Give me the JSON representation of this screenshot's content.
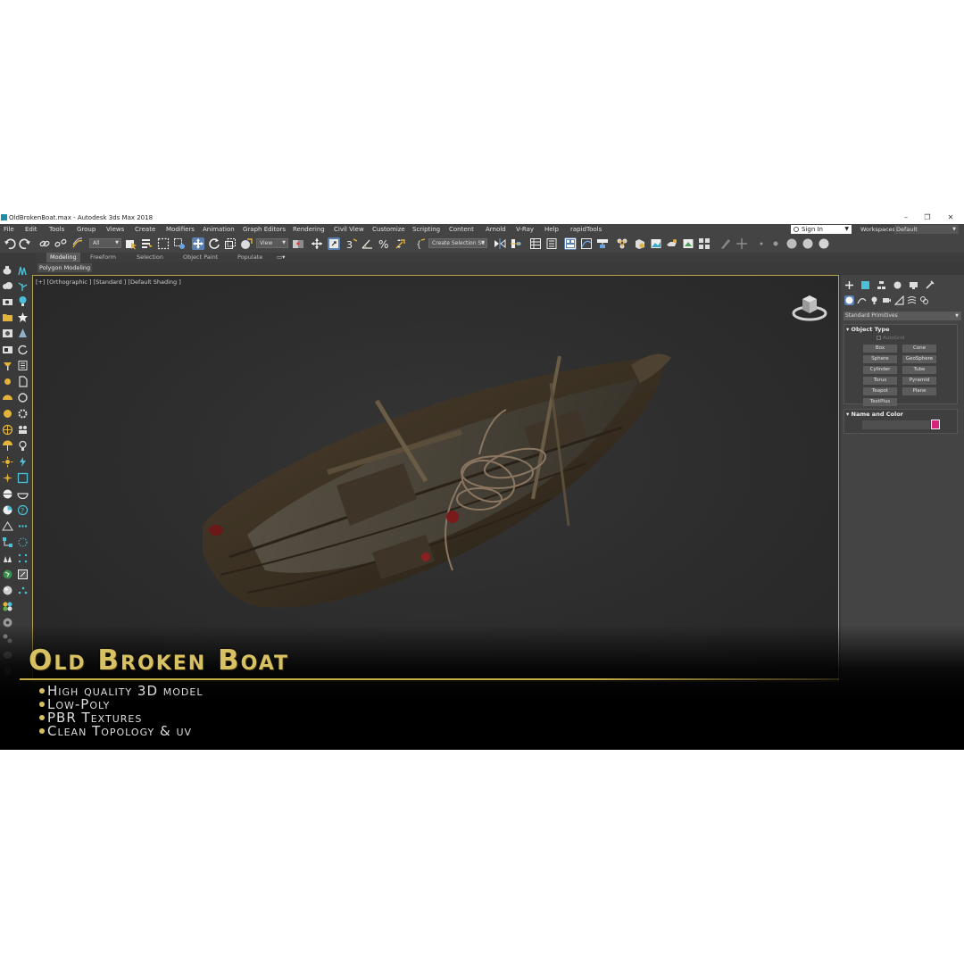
{
  "window": {
    "title": "OldBrokenBoat.max - Autodesk 3ds Max 2018",
    "controls": [
      "–",
      "❐",
      "✕"
    ]
  },
  "menubar": {
    "items": [
      "File",
      "Edit",
      "Tools",
      "Group",
      "Views",
      "Create",
      "Modifiers",
      "Animation",
      "Graph Editors",
      "Rendering",
      "Civil View",
      "Customize",
      "Scripting",
      "Content",
      "Arnold",
      "V-Ray",
      "Help",
      "rapidTools"
    ],
    "sign_in": "Sign In",
    "workspaces_label": "Workspaces:",
    "workspace_value": "Default"
  },
  "toolbar": {
    "selection_filter": "All",
    "ref_coord": "View",
    "named_selection": "Create Selection Se"
  },
  "ribbon": {
    "tabs": [
      "Modeling",
      "Freeform",
      "Selection",
      "Object Paint",
      "Populate"
    ],
    "active_tab": "Modeling",
    "panel_label": "Polygon Modeling"
  },
  "viewport": {
    "label": "[+] [Orthographic ] [Standard ] [Default Shading ]"
  },
  "command_panel": {
    "category": "Standard Primitives",
    "object_type": {
      "title": "Object Type",
      "autogrid": "AutoGrid",
      "buttons": [
        "Box",
        "Cone",
        "Sphere",
        "GeoSphere",
        "Cylinder",
        "Tube",
        "Torus",
        "Pyramid",
        "Teapot",
        "Plane",
        "TextPlus"
      ]
    },
    "name_and_color": {
      "title": "Name and Color",
      "color": "#d4267a"
    }
  },
  "promo": {
    "title": "Old Broken Boat",
    "features": [
      "High quality 3D model",
      "Low-Poly",
      "PBR Textures",
      "Clean Topology & uv"
    ],
    "accent_color": "#d8c163"
  }
}
